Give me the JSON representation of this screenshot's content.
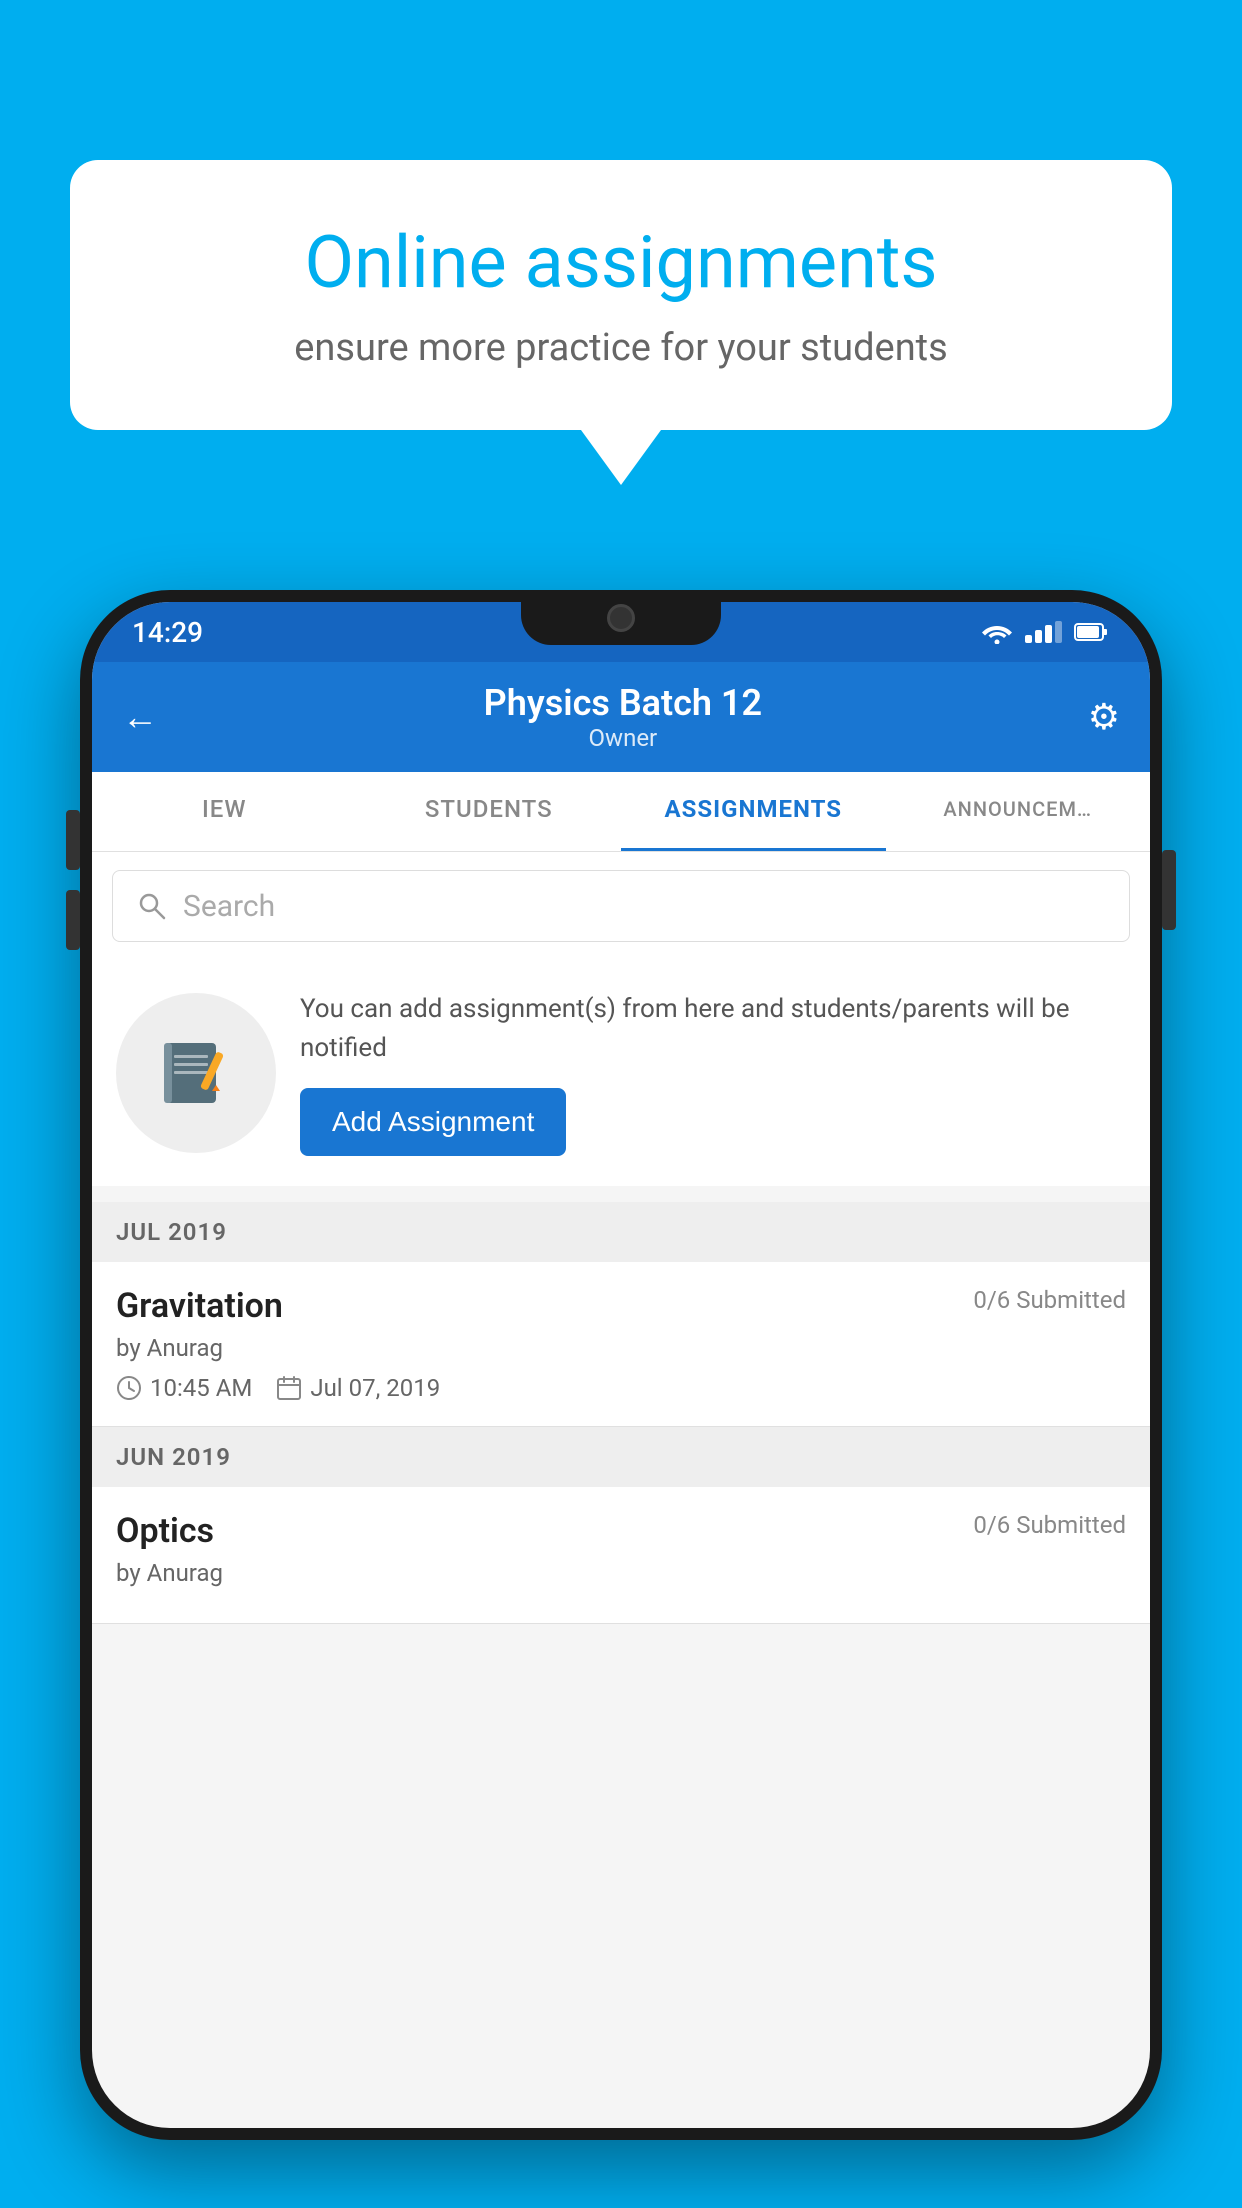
{
  "background": {
    "color": "#00AEEF"
  },
  "speech_bubble": {
    "title": "Online assignments",
    "subtitle": "ensure more practice for your students"
  },
  "status_bar": {
    "time": "14:29"
  },
  "app_header": {
    "title": "Physics Batch 12",
    "subtitle": "Owner",
    "back_label": "←",
    "settings_label": "⚙"
  },
  "tabs": [
    {
      "label": "IEW",
      "active": false
    },
    {
      "label": "STUDENTS",
      "active": false
    },
    {
      "label": "ASSIGNMENTS",
      "active": true
    },
    {
      "label": "ANNOUNCEM…",
      "active": false
    }
  ],
  "search": {
    "placeholder": "Search"
  },
  "empty_state": {
    "description": "You can add assignment(s) from here and students/parents will be notified",
    "button_label": "Add Assignment"
  },
  "sections": [
    {
      "label": "JUL 2019",
      "assignments": [
        {
          "name": "Gravitation",
          "submitted": "0/6 Submitted",
          "by": "by Anurag",
          "time": "10:45 AM",
          "date": "Jul 07, 2019"
        }
      ]
    },
    {
      "label": "JUN 2019",
      "assignments": [
        {
          "name": "Optics",
          "submitted": "0/6 Submitted",
          "by": "by Anurag",
          "time": "",
          "date": ""
        }
      ]
    }
  ]
}
